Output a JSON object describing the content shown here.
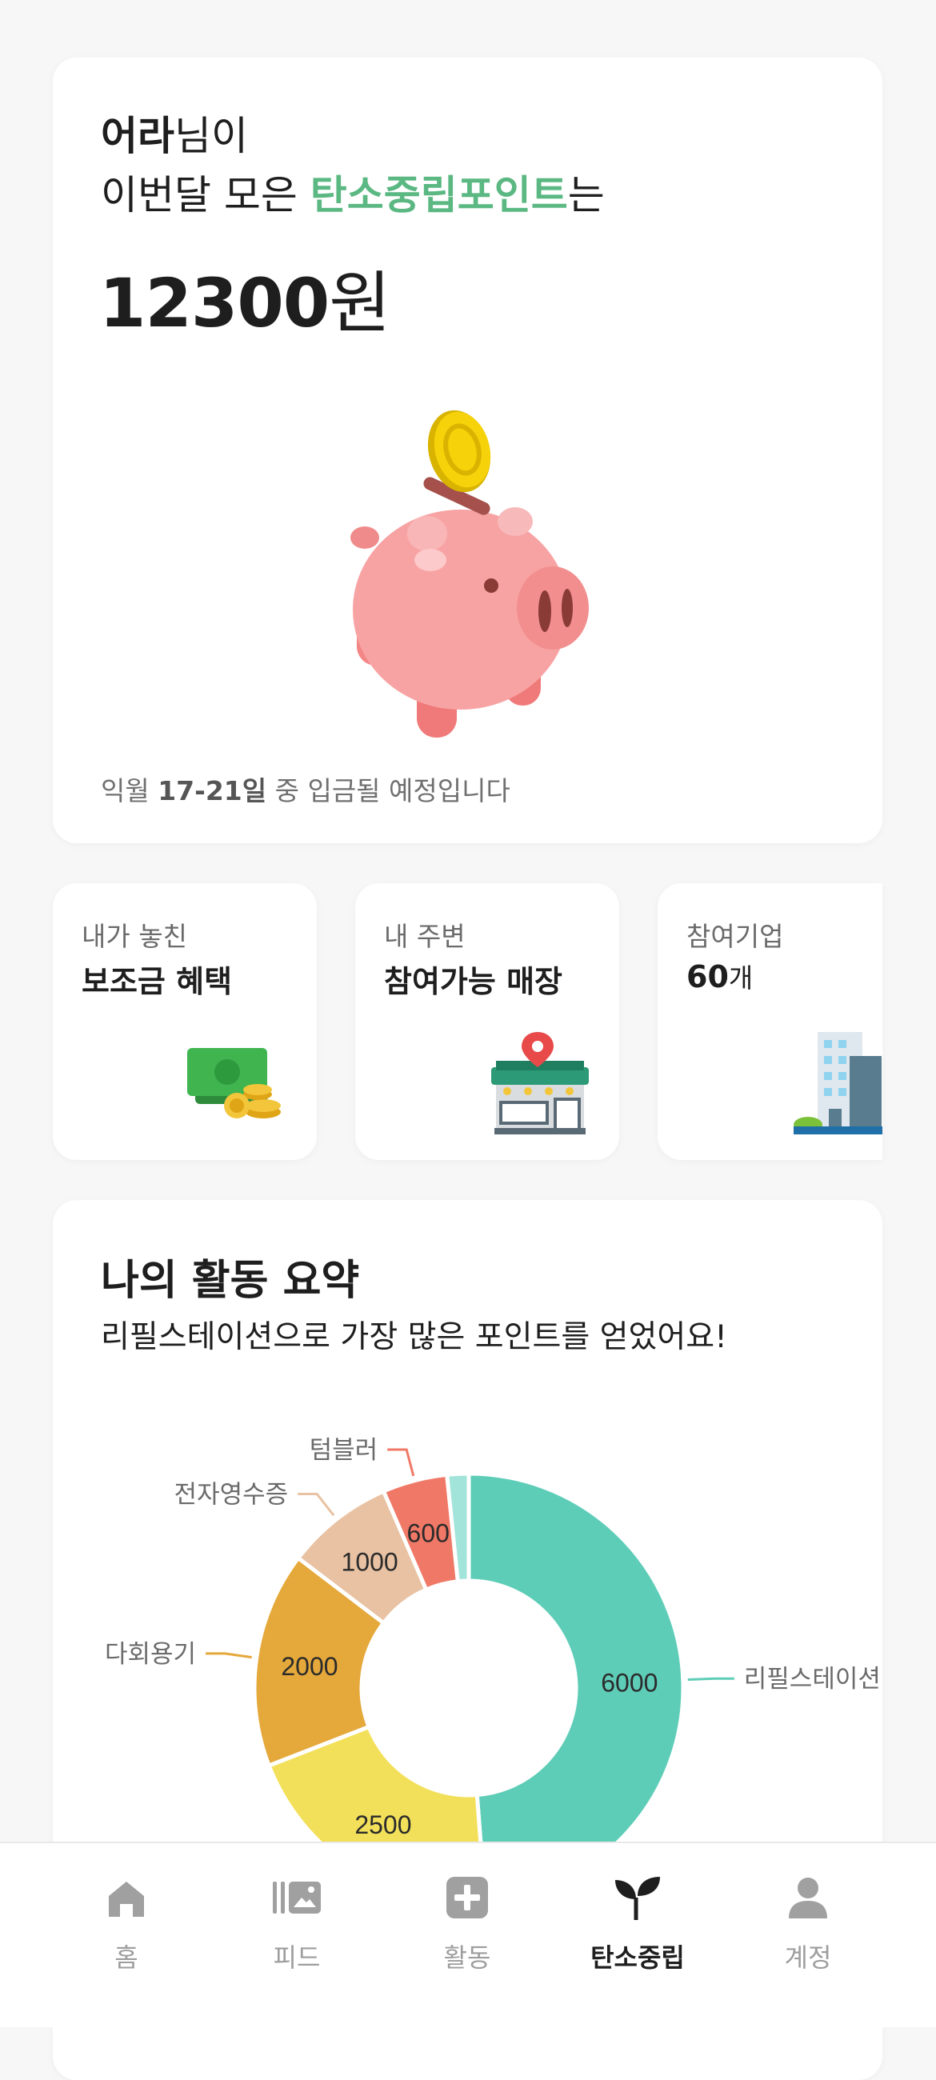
{
  "points_card": {
    "user_name": "어라",
    "greeting_suffix": "님이",
    "line2_prefix": "이번달 모은 ",
    "point_name": "탄소중립포인트",
    "line2_suffix": "는",
    "amount": "12300",
    "amount_unit": "원",
    "note_prefix": "익월 ",
    "note_dates": "17-21일",
    "note_suffix": " 중 입금될 예정입니다",
    "icon": "piggy-bank-icon"
  },
  "small_cards": [
    {
      "sub": "내가 놓친",
      "title": "보조금 혜택",
      "icon": "money-icon"
    },
    {
      "sub": "내 주변",
      "title": "참여가능 매장",
      "icon": "store-location-icon"
    },
    {
      "sub": "참여기업",
      "title": "60",
      "unit": "개",
      "icon": "building-icon"
    }
  ],
  "activity": {
    "title": "나의 활동 요약",
    "description": "리필스테이션으로 가장 많은 포인트를 얻었어요!"
  },
  "chart_data": {
    "type": "pie",
    "subtype": "donut",
    "slices": [
      {
        "label": "리필스테이션",
        "value": 6000,
        "color": "#5ecdb8"
      },
      {
        "label": "",
        "value": 2500,
        "color": "#f3e05a"
      },
      {
        "label": "다회용기",
        "value": 2000,
        "color": "#e5a83a"
      },
      {
        "label": "전자영수증",
        "value": 1000,
        "color": "#e8c2a2"
      },
      {
        "label": "텀블러",
        "value": 600,
        "color": "#f07866"
      },
      {
        "label": "",
        "value": 200,
        "color": "#a2e4da"
      }
    ]
  },
  "nav": {
    "items": [
      {
        "label": "홈",
        "icon": "home-icon",
        "active": false
      },
      {
        "label": "피드",
        "icon": "feed-icon",
        "active": false
      },
      {
        "label": "활동",
        "icon": "plus-icon",
        "active": false
      },
      {
        "label": "탄소중립",
        "icon": "sprout-icon",
        "active": true
      },
      {
        "label": "계정",
        "icon": "person-icon",
        "active": false
      }
    ]
  },
  "colors": {
    "accent_green": "#5bb882",
    "inactive_nav": "#9d9d9d"
  }
}
